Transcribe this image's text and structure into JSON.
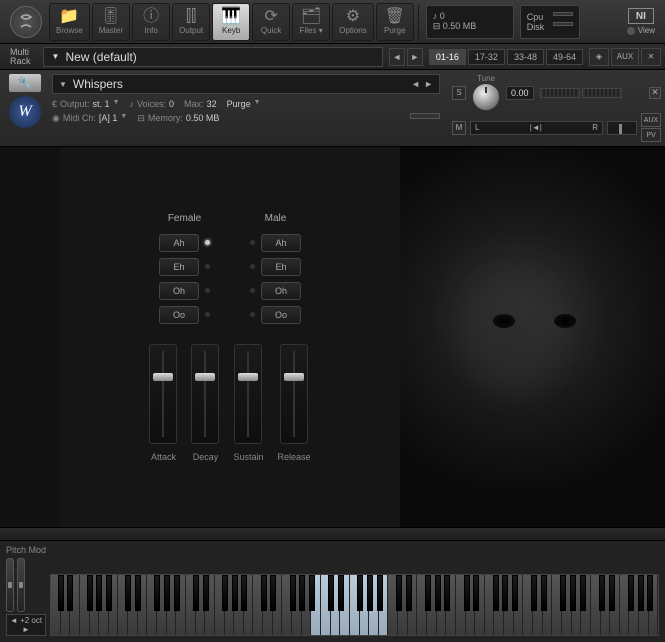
{
  "toolbar": {
    "items": [
      "Browse",
      "Master",
      "Info",
      "Output",
      "Keyb",
      "Quick",
      "Files",
      "Options",
      "Purge"
    ],
    "active": "Keyb",
    "status": {
      "notes_label": "♪ 0",
      "memory": "⊟ 0.50 MB"
    },
    "cpu_label": "Cpu",
    "disk_label": "Disk",
    "view_label": "View"
  },
  "multirack": {
    "label_line1": "Multi",
    "label_line2": "Rack",
    "preset": "New (default)",
    "ranges": [
      "01-16",
      "17-32",
      "33-48",
      "49-64"
    ],
    "active_range": "01-16",
    "aux_label": "AUX"
  },
  "instrument": {
    "name": "Whispers",
    "output_label": "Output:",
    "output_value": "st. 1",
    "midi_label": "Midi Ch:",
    "midi_value": "[A] 1",
    "voices_label": "Voices:",
    "voices_value": "0",
    "max_label": "Max:",
    "max_value": "32",
    "purge_label": "Purge",
    "memory_label": "Memory:",
    "memory_value": "0.50 MB",
    "tune_label": "Tune",
    "tune_value": "0.00",
    "s_label": "S",
    "m_label": "M",
    "pan_l": "L",
    "pan_r": "R",
    "aux_label": "AUX",
    "pv_label": "PV"
  },
  "voices": {
    "female_label": "Female",
    "male_label": "Male",
    "syllables": [
      "Ah",
      "Eh",
      "Oh",
      "Oo"
    ],
    "female_active": "Ah"
  },
  "adsr": {
    "labels": [
      "Attack",
      "Decay",
      "Sustain",
      "Release"
    ],
    "positions": [
      28,
      28,
      28,
      28
    ]
  },
  "keyboard": {
    "pitch_mod_label": "Pitch Mod",
    "octave": "◄ +2 oct ►",
    "lit_range_start": 27,
    "lit_range_end": 34
  }
}
